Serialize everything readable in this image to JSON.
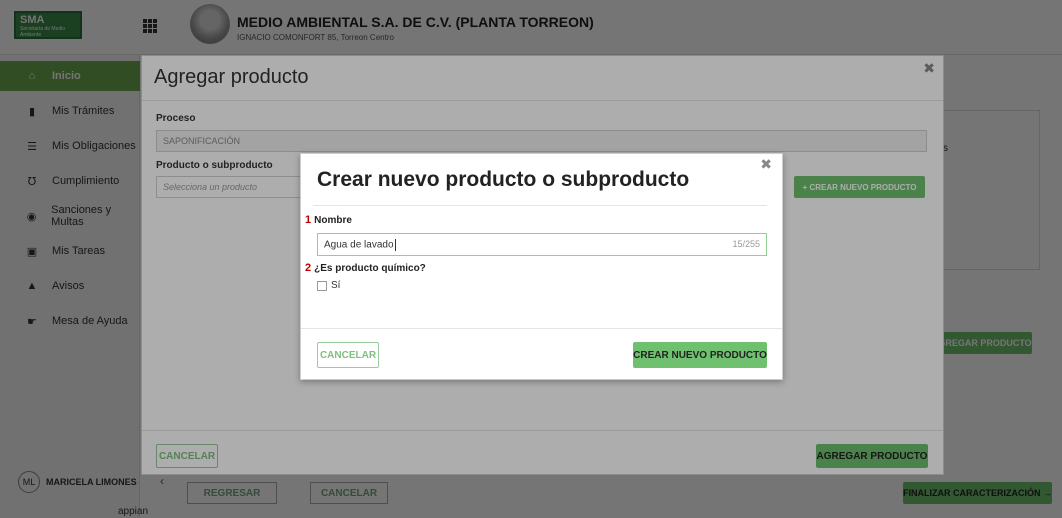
{
  "header": {
    "logo": "SMA",
    "logo_sub": "Secretaría de Medio Ambiente",
    "company_name": "MEDIO AMBIENTAL S.A. DE C.V. (PLANTA TORREON)",
    "company_address": "IGNACIO COMONFORT 85, Torreon Centro"
  },
  "sidebar": {
    "items": [
      {
        "label": "Inicio",
        "icon": "home-icon",
        "active": true
      },
      {
        "label": "Mis Trámites",
        "icon": "file-icon"
      },
      {
        "label": "Mis Obligaciones",
        "icon": "bank-icon"
      },
      {
        "label": "Cumplimiento",
        "icon": "compliance-icon"
      },
      {
        "label": "Sanciones y Multas",
        "icon": "sanction-icon"
      },
      {
        "label": "Mis Tareas",
        "icon": "briefcase-icon"
      },
      {
        "label": "Avisos",
        "icon": "warning-icon"
      },
      {
        "label": "Mesa de Ayuda",
        "icon": "handshake-icon"
      }
    ],
    "user_initials": "ML",
    "user_name": "MARICELA LIMONES",
    "footer_brand": "appian"
  },
  "background": {
    "right_panel_text": "s",
    "gregar_button": "GREGAR PRODUCTO",
    "regresar_button": "REGRESAR",
    "cancelar_button": "CANCELAR",
    "finalizar_button": "FINALIZAR CARACTERIZACIÓN →"
  },
  "modal_agregar": {
    "title": "Agregar producto",
    "proceso_label": "Proceso",
    "proceso_value": "SAPONIFICACIÓN",
    "producto_label": "Producto o subproducto",
    "producto_placeholder": "Selecciona un producto",
    "create_button": "+ CREAR NUEVO PRODUCTO",
    "cancel_button": "CANCELAR",
    "add_button": "AGREGAR PRODUCTO"
  },
  "modal_crear": {
    "title": "Crear nuevo producto o subproducto",
    "field1_number": "1",
    "field1_label": "Nombre",
    "field1_value": "Agua de lavado",
    "field1_counter": "15/255",
    "field2_number": "2",
    "field2_label": "¿Es producto químico?",
    "field2_option": "Sí",
    "cancel_button": "CANCELAR",
    "create_button": "CREAR NUEVO PRODUCTO"
  }
}
